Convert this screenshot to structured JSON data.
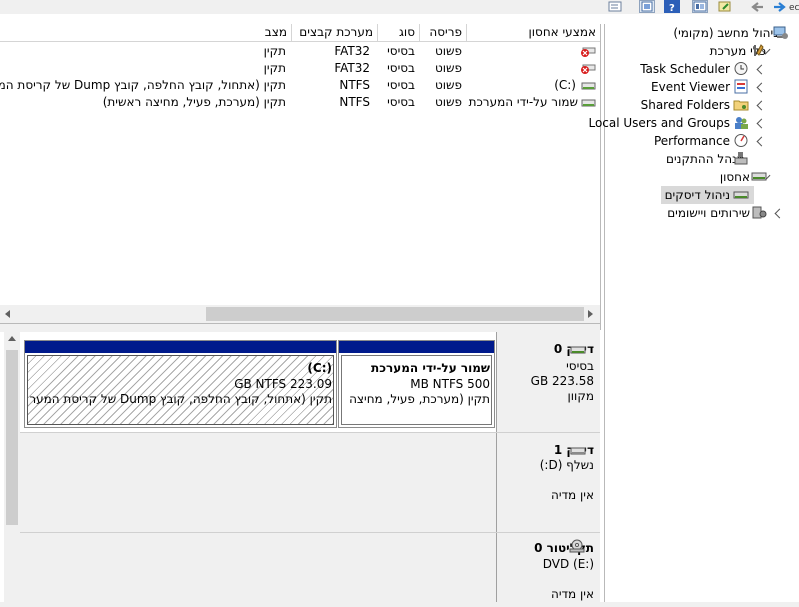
{
  "toolbar": {
    "icons": [
      "partial-icon",
      "properties-icon",
      "help-icon",
      "view-icon",
      "export-icon",
      "back-icon",
      "forward-icon"
    ],
    "edge_text": "ec"
  },
  "list": {
    "columns": [
      "אמצעי אחסון",
      "פריסה",
      "סוג",
      "מערכת קבצים",
      "מצב"
    ],
    "rows": [
      {
        "volume": "",
        "layout": "פשוט",
        "type": "בסיסי",
        "fs": "FAT32",
        "status": "תקין",
        "icon": "error-volume-icon"
      },
      {
        "volume": "",
        "layout": "פשוט",
        "type": "בסיסי",
        "fs": "FAT32",
        "status": "תקין",
        "icon": "error-volume-icon"
      },
      {
        "volume": "(C:)",
        "layout": "פשוט",
        "type": "בסיסי",
        "fs": "NTFS",
        "status": "תקין (אתחול, קובץ החלפה, קובץ Dump של קריסת המ",
        "icon": "drive-icon"
      },
      {
        "volume": "שמור על-ידי המערכת",
        "layout": "פשוט",
        "type": "בסיסי",
        "fs": "NTFS",
        "status": "תקין (מערכת, פעיל, מחיצה ראשית)",
        "icon": "drive-icon"
      }
    ]
  },
  "disks": [
    {
      "name": "דיסק 0",
      "lines": [
        "בסיסי",
        "223.58 GB",
        "מקוון"
      ],
      "partitions": [
        {
          "title": "שמור על-ידי המערכת",
          "size": "500 MB NTFS",
          "status": "תקין (מערכת, פעיל, מחיצה"
        },
        {
          "title": "(C:)",
          "size": "223.09 GB NTFS",
          "status": "תקין (אתחול, קובץ החלפה, קובץ Dump של קריסת המערכ"
        }
      ]
    },
    {
      "name": "דיסק 1",
      "lines": [
        "נשלף (D:)",
        "",
        "אין מדיה"
      ]
    },
    {
      "name": "תקליטור 0",
      "lines": [
        "DVD (E:)",
        "",
        "אין מדיה"
      ]
    }
  ],
  "tree": {
    "items": [
      {
        "label": "ניהול מחשב (מקומי)",
        "icon": "computer-management-icon"
      },
      {
        "label": "כלי מערכת",
        "icon": "system-tools-icon"
      },
      {
        "label": "Task Scheduler",
        "icon": "clock-icon"
      },
      {
        "label": "Event Viewer",
        "icon": "event-viewer-icon"
      },
      {
        "label": "Shared Folders",
        "icon": "shared-folder-icon"
      },
      {
        "label": "Local Users and Groups",
        "icon": "users-icon"
      },
      {
        "label": "Performance",
        "icon": "performance-icon"
      },
      {
        "label": "מנהל ההתקנים",
        "icon": "device-manager-icon"
      },
      {
        "label": "אחסון",
        "icon": "storage-icon"
      },
      {
        "label": "ניהול דיסקים",
        "icon": "disk-management-icon"
      },
      {
        "label": "שירותים ויישומים",
        "icon": "services-icon"
      }
    ]
  },
  "colors": {
    "partition_bar": "#001a8c",
    "selection": "#d9d9d9",
    "error_red": "#d81e1e"
  }
}
